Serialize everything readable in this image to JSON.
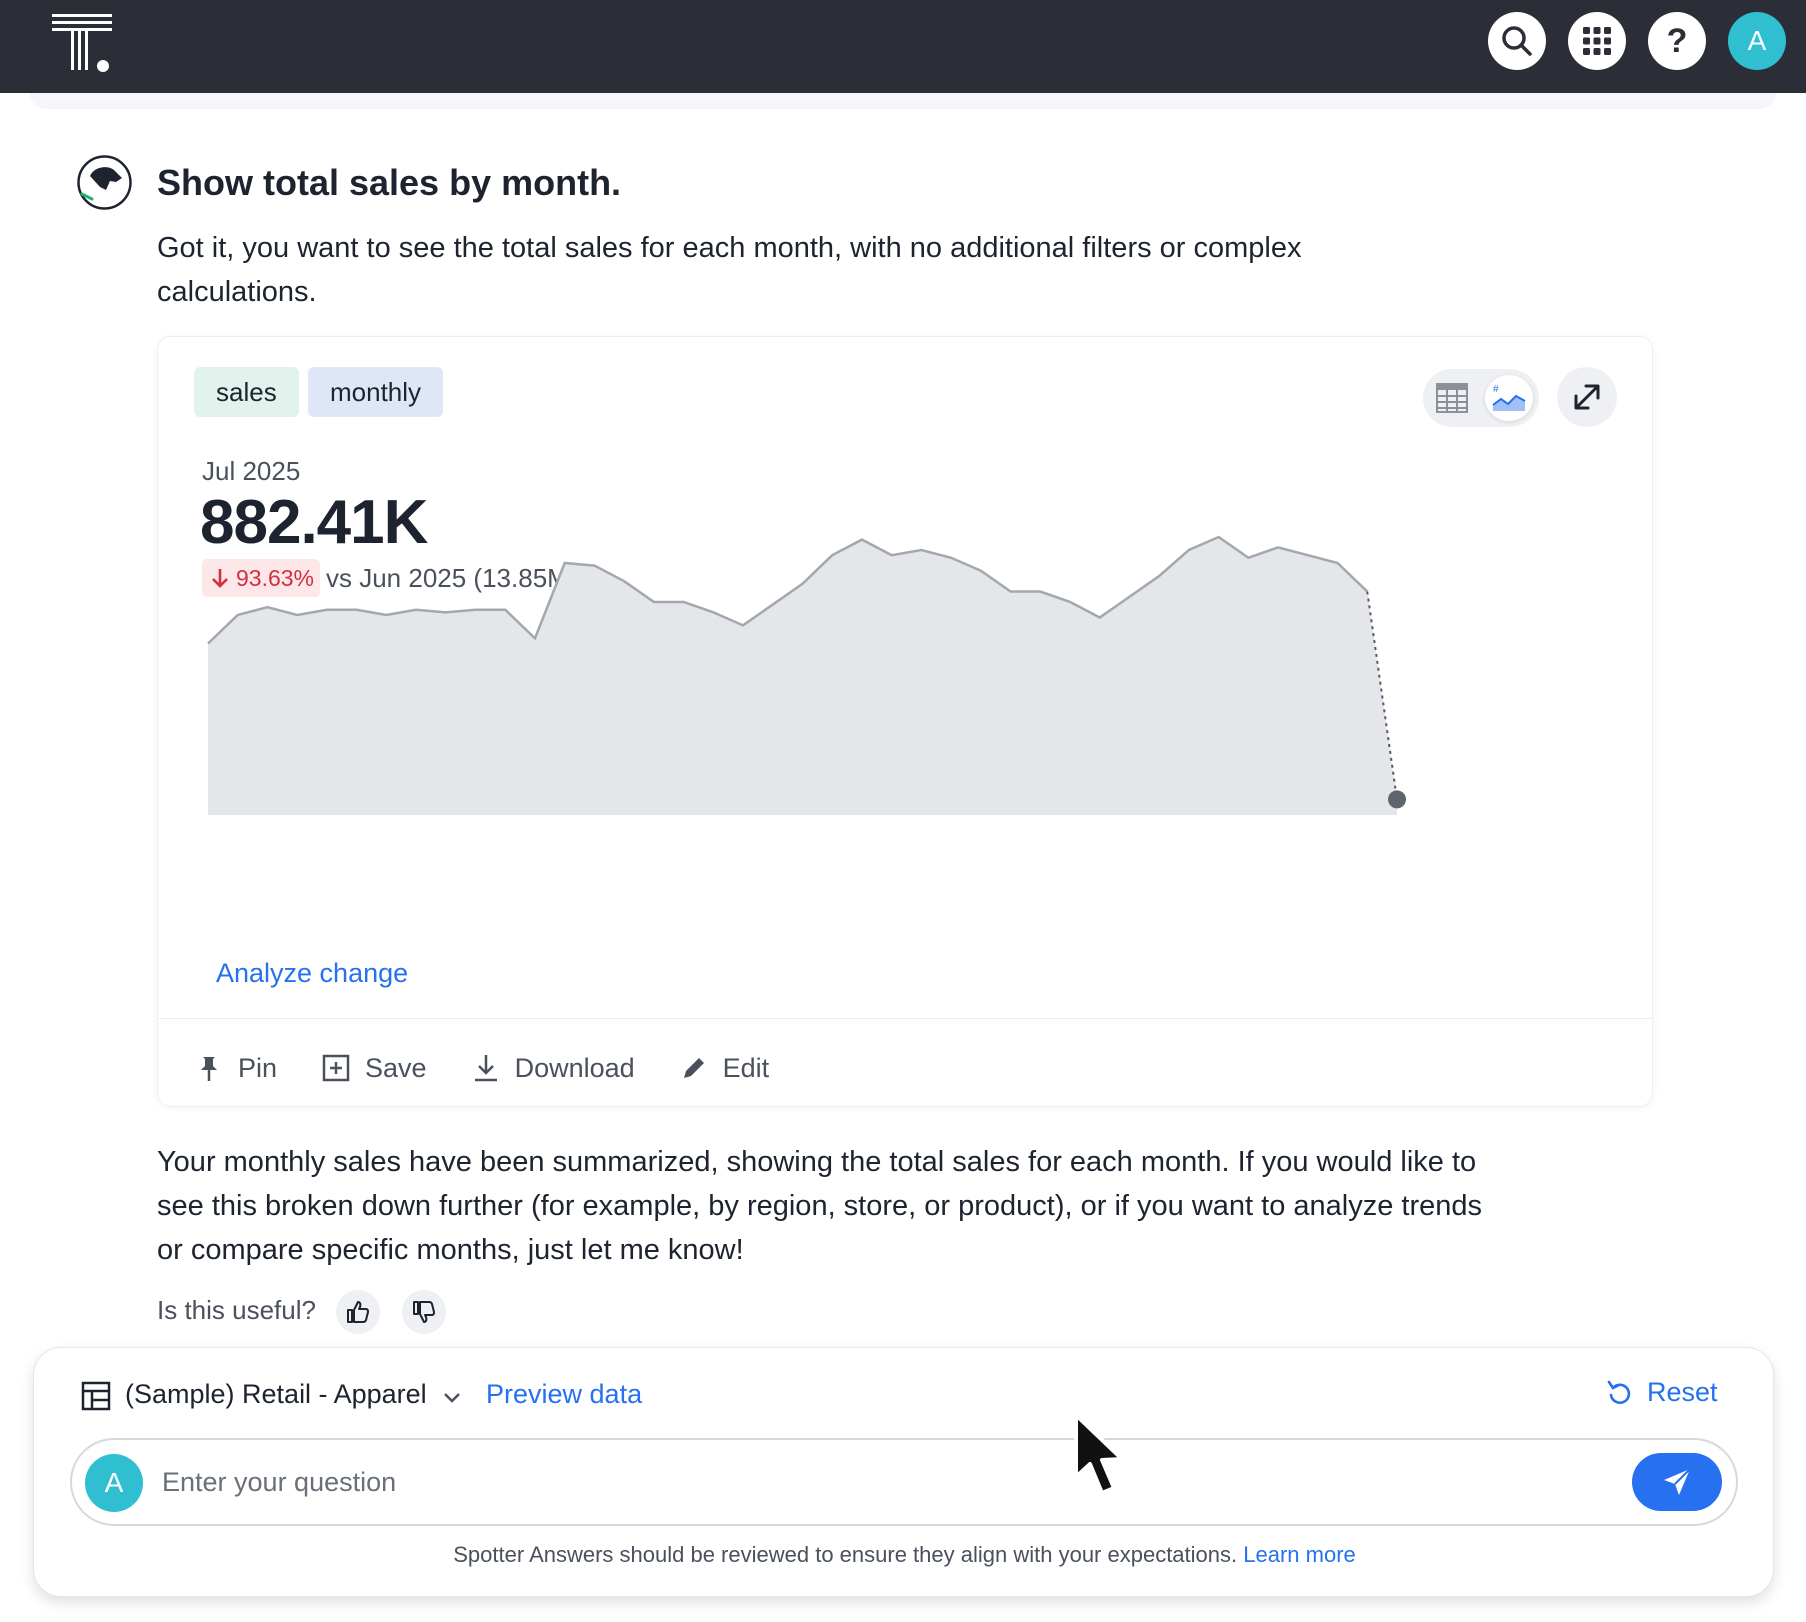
{
  "header": {
    "logo": "thoughtspot-logo",
    "icons": [
      "search-icon",
      "apps-grid-icon",
      "help-icon"
    ],
    "help_glyph": "?",
    "avatar_initial": "A",
    "avatar_color": "#2fbfd0"
  },
  "conversation": {
    "prompt": "Show total sales by month.",
    "intro": "Got it, you want to see the total sales for each month, with no additional filters or complex calculations.",
    "summary": "Your monthly sales have been summarized, showing the total sales for each month. If you would like to see this broken down further (for example, by region, store, or product), or if you want to analyze trends or compare specific months, just let me know!",
    "feedback_prompt": "Is this useful?"
  },
  "answer_card": {
    "tags": [
      "sales",
      "monthly"
    ],
    "period": "Jul 2025",
    "kpi_value": "882.41K",
    "change_pct": "93.63%",
    "change_direction": "down",
    "comparison": "vs Jun 2025 (13.85M)",
    "analyze_link": "Analyze change",
    "actions": {
      "pin": "Pin",
      "save": "Save",
      "download": "Download",
      "edit": "Edit"
    }
  },
  "chart_data": {
    "type": "area",
    "title": "",
    "xlabel": "",
    "ylabel": "",
    "grid": false,
    "legend": "none",
    "fill_color": "#e4e6e9",
    "line_color": "#a3a8ae",
    "series": [
      {
        "values": [
          0.66,
          0.77,
          0.8,
          0.77,
          0.79,
          0.79,
          0.77,
          0.79,
          0.78,
          0.79,
          0.79,
          0.68,
          0.97,
          0.96,
          0.9,
          0.82,
          0.82,
          0.78,
          0.73,
          0.81,
          0.89,
          1.0,
          1.06,
          1.0,
          1.02,
          0.99,
          0.94,
          0.86,
          0.86,
          0.82,
          0.76,
          0.84,
          0.92,
          1.02,
          1.07,
          0.99,
          1.03,
          1.0,
          0.97,
          0.86,
          0.06
        ]
      }
    ]
  },
  "composer": {
    "datasource": "(Sample) Retail - Apparel",
    "preview_label": "Preview data",
    "reset_label": "Reset",
    "placeholder": "Enter your question",
    "avatar_initial": "A",
    "disclaimer": "Spotter Answers should be reviewed to ensure they align with your expectations.",
    "learn_more": "Learn more"
  }
}
